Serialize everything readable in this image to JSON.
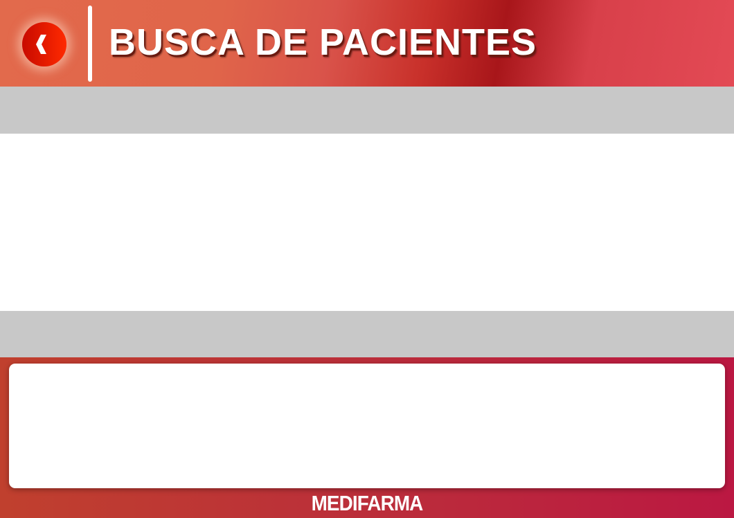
{
  "header": {
    "title": "BUSCA DE PACIENTES",
    "back_icon": "chevron-left-icon"
  },
  "footer": {
    "brand": "MEDIFARMA"
  },
  "colors": {
    "accent": "#e2261a",
    "band": "#c8c8c8",
    "footer": "#bb1842"
  }
}
